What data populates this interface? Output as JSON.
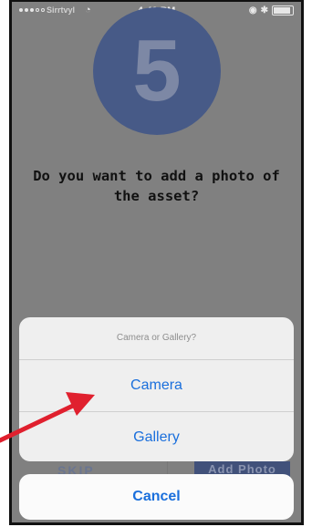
{
  "status_bar": {
    "carrier": "Sirrtvyl",
    "time": "4:40 PM",
    "battery_level": 0.9
  },
  "step": {
    "number": "5"
  },
  "question": {
    "text": "Do you want to add a photo of the asset?"
  },
  "background_buttons": {
    "left": "SKIP",
    "right": "Add Photo"
  },
  "action_sheet": {
    "title": "Camera or Gallery?",
    "options": [
      "Camera",
      "Gallery"
    ],
    "cancel": "Cancel"
  },
  "colors": {
    "accent": "#1a6fdc",
    "step_circle": "#475a87",
    "annotation_arrow": "#e0202e"
  },
  "icons": [
    "signal-dots-icon",
    "wifi-icon",
    "location-icon",
    "bluetooth-icon",
    "battery-icon",
    "annotation-arrow-icon"
  ]
}
